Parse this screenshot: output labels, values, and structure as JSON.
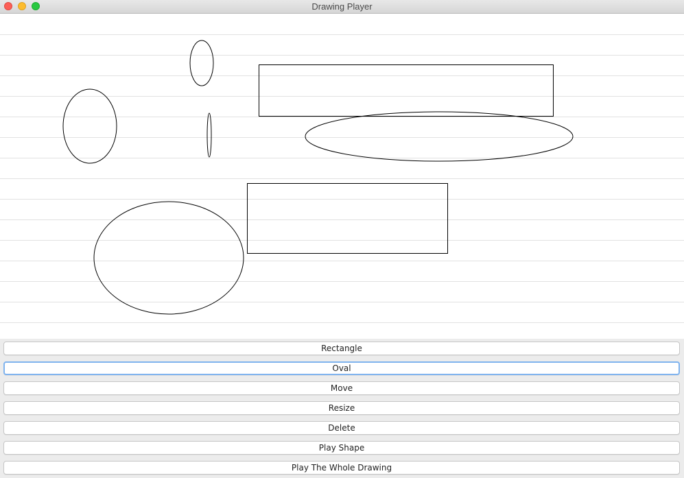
{
  "window": {
    "title": "Drawing Player"
  },
  "buttons": [
    {
      "label": "Rectangle",
      "focused": false
    },
    {
      "label": "Oval",
      "focused": true
    },
    {
      "label": "Move",
      "focused": false
    },
    {
      "label": "Resize",
      "focused": false
    },
    {
      "label": "Delete",
      "focused": false
    },
    {
      "label": "Play Shape",
      "focused": false
    },
    {
      "label": "Play The Whole Drawing",
      "focused": false
    }
  ],
  "canvas": {
    "background": "#ffffff",
    "rule_line_color": "#e1e1e1",
    "stroke_color": "#000000",
    "shapes": [
      {
        "type": "oval"
      },
      {
        "type": "oval"
      },
      {
        "type": "oval"
      },
      {
        "type": "rectangle"
      },
      {
        "type": "oval"
      },
      {
        "type": "rectangle"
      },
      {
        "type": "oval"
      }
    ]
  }
}
